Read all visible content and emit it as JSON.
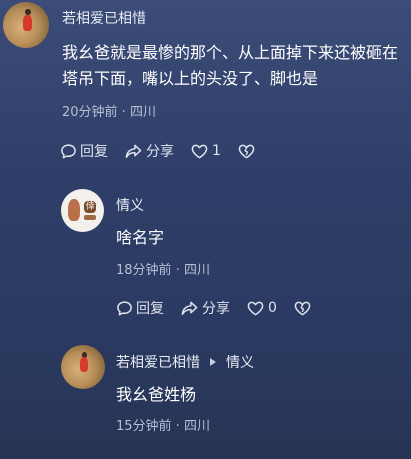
{
  "comments": [
    {
      "username": "若相爱已相惜",
      "content": "我幺爸就是最惨的那个、从上面掉下来还被砸在塔吊下面，嘴以上的头没了、脚也是",
      "meta": "20分钟前 · 四川",
      "actions": {
        "reply": "回复",
        "share": "分享",
        "like_count": "1"
      }
    },
    {
      "username": "情义",
      "content": "啥名字",
      "meta": "18分钟前 · 四川",
      "actions": {
        "reply": "回复",
        "share": "分享",
        "like_count": "0"
      }
    },
    {
      "username": "若相爱已相惜",
      "reply_to": "情义",
      "content": "我幺爸姓杨",
      "meta": "15分钟前 · 四川"
    }
  ],
  "colors": {
    "background_top": "#3b4c78",
    "background_bottom": "#263454",
    "text_primary": "#ffffff",
    "text_meta": "#b7bfd4"
  },
  "icons": [
    "comment-icon",
    "share-icon",
    "heart-icon",
    "broken-heart-icon"
  ]
}
